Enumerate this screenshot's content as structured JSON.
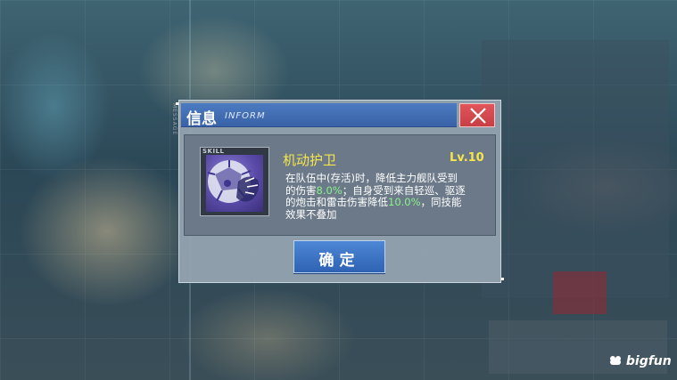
{
  "dialog": {
    "title": "信息",
    "subtitle": "INFORM",
    "confirm_label": "确定"
  },
  "skill": {
    "tag": "SKILL",
    "name": "机动护卫",
    "level": "Lv.10",
    "desc": {
      "line1": "在队伍中(存活)时，降低主力舰队受到",
      "line2_a": "的伤害",
      "value1": "8.0%",
      "line2_b": "；自身受到来自轻巡、驱逐",
      "line3_a": "的炮击和雷击伤害降低",
      "value2": "10.0%",
      "line3_b": "，同技能",
      "line4": "效果不叠加"
    }
  },
  "background": {
    "side_label": "MESSAGE"
  },
  "watermark": "bigfun",
  "colors": {
    "title_bar": "#3f6cb4",
    "close_button": "#d44a50",
    "highlight_text": "#8af28a",
    "skill_name": "#f6e64b",
    "confirm_button": "#3a71c4"
  },
  "icons": [
    "close-icon",
    "skill-icon",
    "bigfun-logo-icon"
  ]
}
